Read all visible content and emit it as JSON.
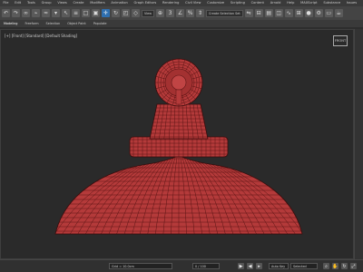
{
  "menu": [
    "File",
    "Edit",
    "Tools",
    "Group",
    "Views",
    "Create",
    "Modifiers",
    "Animation",
    "Graph Editors",
    "Rendering",
    "Civil View",
    "Customize",
    "Scripting",
    "Content",
    "Arnold",
    "Help",
    "MAXScript",
    "Substance",
    "Issues"
  ],
  "toolbar": {
    "icons": [
      {
        "name": "undo-icon",
        "glyph": "↶",
        "active": false
      },
      {
        "name": "redo-icon",
        "glyph": "↷",
        "active": false
      },
      {
        "name": "link-icon",
        "glyph": "∞",
        "active": false
      },
      {
        "name": "unlink-icon",
        "glyph": "⌁",
        "active": false
      },
      {
        "name": "bind-icon",
        "glyph": "≈",
        "active": false
      },
      {
        "name": "selection-filter-icon",
        "glyph": "▾",
        "active": false
      },
      {
        "name": "select-icon",
        "glyph": "↖",
        "active": false
      },
      {
        "name": "select-by-name-icon",
        "glyph": "≡",
        "active": false
      },
      {
        "name": "select-region-icon",
        "glyph": "□",
        "active": false
      },
      {
        "name": "window-crossing-icon",
        "glyph": "▣",
        "active": false
      },
      {
        "name": "move-icon",
        "glyph": "✛",
        "active": true
      },
      {
        "name": "rotate-icon",
        "glyph": "↻",
        "active": false
      },
      {
        "name": "scale-icon",
        "glyph": "◰",
        "active": false
      },
      {
        "name": "place-icon",
        "glyph": "◇",
        "active": false
      },
      {
        "name": "reference-coord-dropdown",
        "glyph": "",
        "active": false
      },
      {
        "name": "pivot-icon",
        "glyph": "⊕",
        "active": false
      },
      {
        "name": "snap-toggle-icon",
        "glyph": "3",
        "active": false
      },
      {
        "name": "angle-snap-icon",
        "glyph": "∠",
        "active": false
      },
      {
        "name": "percent-snap-icon",
        "glyph": "%",
        "active": false
      },
      {
        "name": "spinner-snap-icon",
        "glyph": "⇕",
        "active": false
      },
      {
        "name": "named-selection-dropdown",
        "glyph": "",
        "active": false
      },
      {
        "name": "mirror-icon",
        "glyph": "⇋",
        "active": false
      },
      {
        "name": "align-icon",
        "glyph": "⊟",
        "active": false
      },
      {
        "name": "layer-icon",
        "glyph": "▤",
        "active": false
      },
      {
        "name": "graphite-icon",
        "glyph": "◫",
        "active": false
      },
      {
        "name": "curve-editor-icon",
        "glyph": "∿",
        "active": false
      },
      {
        "name": "schematic-icon",
        "glyph": "⊞",
        "active": false
      },
      {
        "name": "material-editor-icon",
        "glyph": "●",
        "active": false
      },
      {
        "name": "render-setup-icon",
        "glyph": "⚙",
        "active": false
      },
      {
        "name": "render-frame-icon",
        "glyph": "▭",
        "active": false
      },
      {
        "name": "render-icon",
        "glyph": "☕",
        "active": false
      }
    ],
    "reference_coord": "View",
    "named_selection": "Create Selection Set"
  },
  "ribbon": {
    "tabs": [
      "Modeling",
      "Freeform",
      "Selection",
      "Object Paint",
      "Populate"
    ]
  },
  "viewport": {
    "label": "[+] [Front] [Standard] [Default Shading]",
    "viewcube_label": "FRONT"
  },
  "timeline": {
    "frame_field": "0 / 100",
    "status_text": "Grid = 10.0cm",
    "auto_key_label": "Auto Key",
    "set_key_label": "Selected"
  },
  "colors": {
    "mesh_fill": "#b43a3a",
    "mesh_wire": "#5a1414",
    "viewport_bg": "#2a2a2a"
  }
}
